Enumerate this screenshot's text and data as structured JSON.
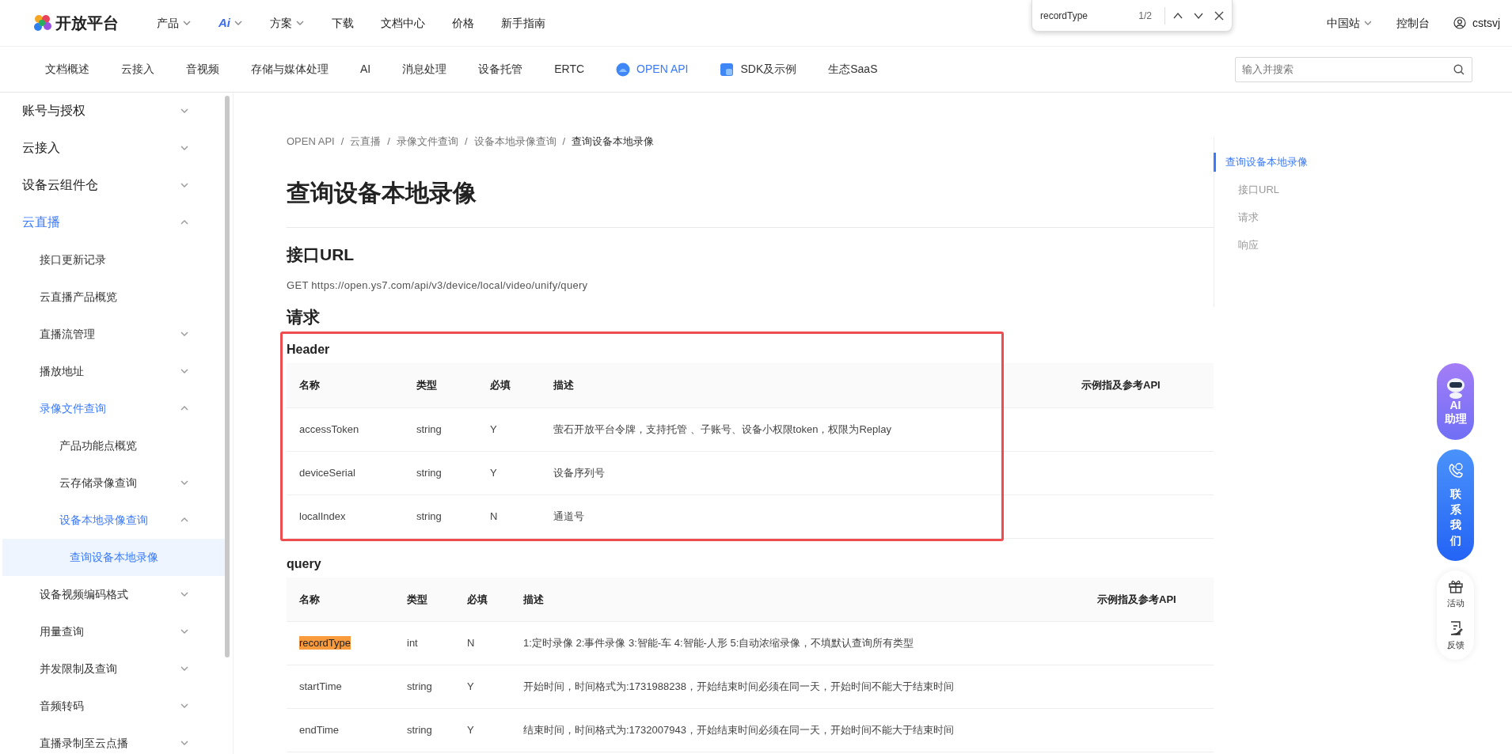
{
  "topnav": {
    "logo": "开放平台",
    "items": [
      {
        "label": "产品",
        "kind": "text",
        "dropdown": true
      },
      {
        "label": "Ai",
        "kind": "logo",
        "dropdown": true
      },
      {
        "label": "方案",
        "kind": "text",
        "dropdown": true
      },
      {
        "label": "下载",
        "kind": "text",
        "dropdown": false
      },
      {
        "label": "文档中心",
        "kind": "text",
        "dropdown": false
      },
      {
        "label": "价格",
        "kind": "text",
        "dropdown": false
      },
      {
        "label": "新手指南",
        "kind": "text",
        "dropdown": false
      }
    ],
    "region": {
      "label": "中国站",
      "dropdown": true
    },
    "console": "控制台",
    "user": "cstsvj"
  },
  "find_bar": {
    "query": "recordType",
    "count": "1/2"
  },
  "subnav": {
    "items": [
      {
        "label": "文档概述",
        "kind": "plain",
        "selected": false
      },
      {
        "label": "云接入",
        "kind": "plain",
        "selected": false
      },
      {
        "label": "音视频",
        "kind": "plain",
        "selected": false
      },
      {
        "label": "存储与媒体处理",
        "kind": "plain",
        "selected": false
      },
      {
        "label": "AI",
        "kind": "plain",
        "selected": false
      },
      {
        "label": "消息处理",
        "kind": "plain",
        "selected": false
      },
      {
        "label": "设备托管",
        "kind": "plain",
        "selected": false
      },
      {
        "label": "ERTC",
        "kind": "plain",
        "selected": false
      },
      {
        "label": "OPEN API",
        "kind": "api",
        "selected": true
      },
      {
        "label": "SDK及示例",
        "kind": "sdk",
        "selected": false
      },
      {
        "label": "生态SaaS",
        "kind": "plain",
        "selected": false
      }
    ],
    "search": {
      "placeholder": "输入并搜索"
    }
  },
  "sidebar": {
    "items": [
      {
        "label": "账号与授权",
        "expanded": false,
        "selected": false
      },
      {
        "label": "云接入",
        "expanded": false,
        "selected": false
      },
      {
        "label": "设备云组件仓",
        "expanded": false,
        "selected": false
      },
      {
        "label": "云直播",
        "expanded": true,
        "selected": false,
        "children": [
          {
            "label": "接口更新记录",
            "selected": false
          },
          {
            "label": "云直播产品概览",
            "selected": false
          },
          {
            "label": "直播流管理",
            "expanded": false,
            "selected": false
          },
          {
            "label": "播放地址",
            "expanded": false,
            "selected": false
          },
          {
            "label": "录像文件查询",
            "expanded": true,
            "selected": false,
            "children": [
              {
                "label": "产品功能点概览",
                "selected": false
              },
              {
                "label": "云存储录像查询",
                "expanded": false,
                "selected": false
              },
              {
                "label": "设备本地录像查询",
                "expanded": true,
                "selected": false,
                "children": [
                  {
                    "label": "查询设备本地录像",
                    "selected": true
                  }
                ]
              }
            ]
          },
          {
            "label": "设备视频编码格式",
            "expanded": false,
            "selected": false
          },
          {
            "label": "用量查询",
            "expanded": false,
            "selected": false
          },
          {
            "label": "并发限制及查询",
            "expanded": false,
            "selected": false
          },
          {
            "label": "音频转码",
            "expanded": false,
            "selected": false
          },
          {
            "label": "直播录制至云点播",
            "expanded": false,
            "selected": false
          }
        ]
      }
    ]
  },
  "breadcrumb": {
    "separator": "/",
    "items": [
      "OPEN API",
      "云直播",
      "录像文件查询",
      "设备本地录像查询",
      "查询设备本地录像"
    ]
  },
  "title": "查询设备本地录像",
  "url_section": {
    "heading": "接口URL",
    "text": "GET https://open.ys7.com/api/v3/device/local/video/unify/query"
  },
  "request": {
    "heading": "请求",
    "tables": [
      {
        "title": "Header",
        "highlight_box": true,
        "columns": [
          "名称",
          "类型",
          "必填",
          "描述",
          "示例指及参考API"
        ],
        "rows": [
          {
            "cells": [
              "accessToken",
              "string",
              "Y",
              "萤石开放平台令牌，支持托管 、子账号、设备小权限token，权限为Replay"
            ],
            "highlighted": false
          },
          {
            "cells": [
              "deviceSerial",
              "string",
              "Y",
              "设备序列号"
            ],
            "highlighted": false
          },
          {
            "cells": [
              "localIndex",
              "string",
              "N",
              "通道号"
            ],
            "highlighted": false
          }
        ]
      },
      {
        "title": "query",
        "highlight_box": false,
        "columns": [
          "名称",
          "类型",
          "必填",
          "描述",
          "示例指及参考API"
        ],
        "rows": [
          {
            "cells": [
              "recordType",
              "int",
              "N",
              "1:定时录像 2:事件录像 3:智能-车 4:智能-人形 5:自动浓缩录像，不填默认查询所有类型"
            ],
            "highlighted": true
          },
          {
            "cells": [
              "startTime",
              "string",
              "Y",
              "开始时间，时间格式为:1731988238，开始结束时间必须在同一天，开始时间不能大于结束时间"
            ],
            "highlighted": false
          },
          {
            "cells": [
              "endTime",
              "string",
              "Y",
              "结束时间，时间格式为:1732007943，开始结束时间必须在同一天，开始时间不能大于结束时间"
            ],
            "highlighted": false
          }
        ]
      }
    ]
  },
  "toc": [
    {
      "label": "查询设备本地录像",
      "selected": true,
      "children": [
        {
          "label": "接口URL",
          "selected": false
        },
        {
          "label": "请求",
          "selected": false
        },
        {
          "label": "响应",
          "selected": false
        }
      ]
    }
  ],
  "float_buttons": [
    {
      "kind": "ai",
      "lines": [
        "AI",
        "助理"
      ]
    },
    {
      "kind": "contact",
      "label": "联系我们"
    },
    {
      "kind": "gift",
      "label": "活动"
    },
    {
      "kind": "feedback",
      "label": "反馈"
    }
  ]
}
